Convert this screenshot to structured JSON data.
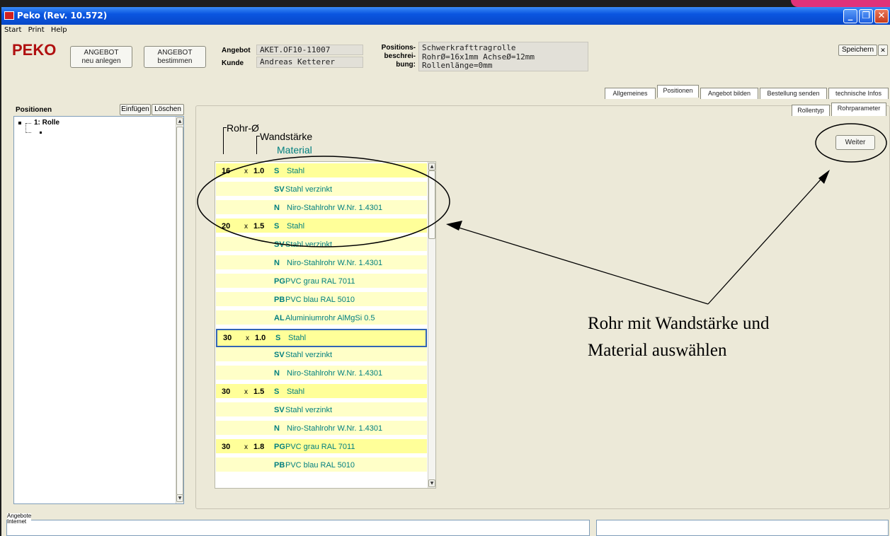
{
  "window": {
    "title": "Peko  (Rev. 10.572)",
    "controls": [
      "_",
      "❐",
      "✕"
    ]
  },
  "menu": [
    "Start",
    "Print",
    "Help"
  ],
  "logo": "PEKO",
  "toolbar": {
    "btn_new_line1": "ANGEBOT",
    "btn_new_line2": "neu anlegen",
    "btn_det_line1": "ANGEBOT",
    "btn_det_line2": "bestimmen",
    "save": "Speichern",
    "close": "✕"
  },
  "header": {
    "angebot_label": "Angebot",
    "angebot_value": "AKET.OF10-11007",
    "kunde_label": "Kunde",
    "kunde_value": "Andreas Ketterer",
    "pos_label_1": "Positions-",
    "pos_label_2": "beschrei-",
    "pos_label_3": "bung:",
    "pos_desc_1": "Schwerkrafttragrolle",
    "pos_desc_2": "RohrØ=16x1mm AchseØ=12mm",
    "pos_desc_3": "Rollenlänge=0mm"
  },
  "tabs": [
    "Allgemeines",
    "Positionen",
    "Angebot bilden",
    "Bestellung senden",
    "technische Infos"
  ],
  "subtabs": [
    "Rollentyp",
    "Rohrparameter"
  ],
  "positions": {
    "title": "Positionen",
    "insert": "Einfügen",
    "delete": "Löschen",
    "tree_item": "1: Rolle"
  },
  "columns": {
    "rohr": "Rohr-Ø",
    "wand": "Wandstärke",
    "material": "Material"
  },
  "weiter": "Weiter",
  "rows": [
    {
      "d": "16",
      "x": "x",
      "w": "1.0",
      "c": "S",
      "m": "Stahl"
    },
    {
      "d": "",
      "x": "",
      "w": "",
      "c": "SV",
      "m": "Stahl verzinkt"
    },
    {
      "d": "",
      "x": "",
      "w": "",
      "c": "N",
      "m": "Niro-Stahlrohr W.Nr. 1.4301"
    },
    {
      "d": "20",
      "x": "x",
      "w": "1.5",
      "c": "S",
      "m": "Stahl"
    },
    {
      "d": "",
      "x": "",
      "w": "",
      "c": "SV",
      "m": "Stahl verzinkt"
    },
    {
      "d": "",
      "x": "",
      "w": "",
      "c": "N",
      "m": "Niro-Stahlrohr W.Nr. 1.4301"
    },
    {
      "d": "",
      "x": "",
      "w": "",
      "c": "PG",
      "m": "PVC grau RAL 7011"
    },
    {
      "d": "",
      "x": "",
      "w": "",
      "c": "PB",
      "m": "PVC blau RAL 5010"
    },
    {
      "d": "",
      "x": "",
      "w": "",
      "c": "AL",
      "m": "Aluminiumrohr AlMgSi 0.5"
    },
    {
      "d": "30",
      "x": "x",
      "w": "1.0",
      "c": "S",
      "m": "Stahl"
    },
    {
      "d": "",
      "x": "",
      "w": "",
      "c": "SV",
      "m": "Stahl verzinkt"
    },
    {
      "d": "",
      "x": "",
      "w": "",
      "c": "N",
      "m": "Niro-Stahlrohr W.Nr. 1.4301"
    },
    {
      "d": "30",
      "x": "x",
      "w": "1.5",
      "c": "S",
      "m": "Stahl"
    },
    {
      "d": "",
      "x": "",
      "w": "",
      "c": "SV",
      "m": "Stahl verzinkt"
    },
    {
      "d": "",
      "x": "",
      "w": "",
      "c": "N",
      "m": "Niro-Stahlrohr W.Nr. 1.4301"
    },
    {
      "d": "30",
      "x": "x",
      "w": "1.8",
      "c": "PG",
      "m": "PVC grau RAL 7011"
    },
    {
      "d": "",
      "x": "",
      "w": "",
      "c": "PB",
      "m": "PVC blau RAL 5010"
    }
  ],
  "annotation": {
    "line1": "Rohr mit Wandstärke und",
    "line2": "Material auswählen"
  },
  "bottom_tab": {
    "line1": "Angebote",
    "line2": "Internet"
  }
}
